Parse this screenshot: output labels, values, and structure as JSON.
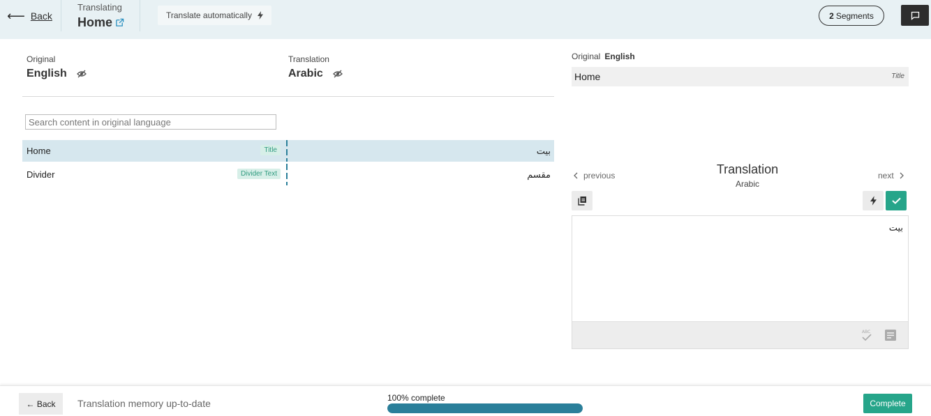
{
  "header": {
    "back_label": "Back",
    "translating_label": "Translating",
    "page_name": "Home",
    "auto_translate_label": "Translate automatically",
    "segments_count": "2",
    "segments_label": "Segments"
  },
  "languages": {
    "original_caption": "Original",
    "original_language": "English",
    "translation_caption": "Translation",
    "translation_language": "Arabic"
  },
  "search": {
    "placeholder": "Search content in original language",
    "value": ""
  },
  "segments": [
    {
      "original": "Home",
      "type": "Title",
      "translation": "بيت",
      "selected": true
    },
    {
      "original": "Divider",
      "type": "Divider Text",
      "translation": "مقسم",
      "selected": false
    }
  ],
  "editor": {
    "original_caption": "Original",
    "original_language": "English",
    "source_text": "Home",
    "source_type": "Title",
    "previous_label": "previous",
    "next_label": "next",
    "panel_title": "Translation",
    "panel_language": "Arabic",
    "translation_value": "بيت"
  },
  "footer": {
    "back_label": "← Back",
    "status_text": "Translation memory up-to-date",
    "progress_label": "100% complete",
    "progress_value": 100,
    "complete_label": "Complete"
  },
  "colors": {
    "header_bg": "#e8f1f4",
    "accent_green": "#26a58a",
    "progress_blue": "#2a7f9a",
    "selected_row": "#d6e7ee"
  }
}
